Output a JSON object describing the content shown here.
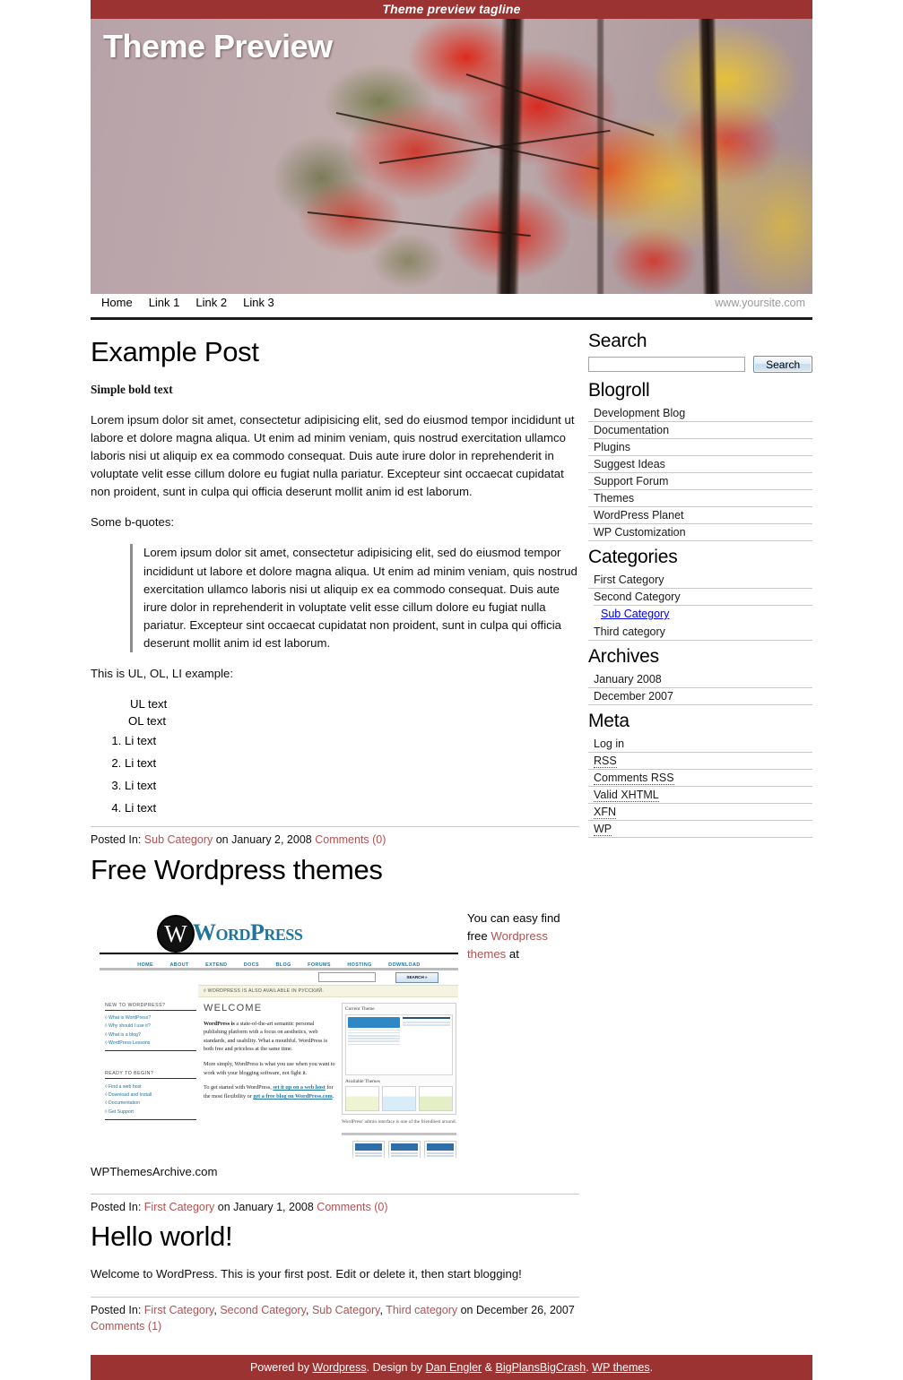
{
  "theme": {
    "accent_red": "#9c3333",
    "link_red": "#b05252",
    "site_title": "Theme Preview",
    "tagline": "Theme preview tagline"
  },
  "nav": {
    "items": [
      {
        "label": "Home"
      },
      {
        "label": "Link 1"
      },
      {
        "label": "Link 2"
      },
      {
        "label": "Link 3"
      }
    ],
    "site_url": "www.yoursite.com"
  },
  "posts": [
    {
      "title": "Example Post",
      "bold_lead": "Simple bold text",
      "paragraph": "Lorem ipsum dolor sit amet, consectetur adipisicing elit, sed do eiusmod tempor incididunt ut labore et dolore magna aliqua. Ut enim ad minim veniam, quis nostrud exercitation ullamco laboris nisi ut aliquip ex ea commodo consequat. Duis aute irure dolor in reprehenderit in voluptate velit esse cillum dolore eu fugiat nulla pariatur. Excepteur sint occaecat cupidatat non proident, sunt in culpa qui officia deserunt mollit anim id est laborum.",
      "bquote_intro": "Some b-quotes:",
      "blockquote": "Lorem ipsum dolor sit amet, consectetur adipisicing elit, sed do eiusmod tempor incididunt ut labore et dolore magna aliqua. Ut enim ad minim veniam, quis nostrud exercitation ullamco laboris nisi ut aliquip ex ea commodo consequat. Duis aute irure dolor in reprehenderit in voluptate velit esse cillum dolore eu fugiat nulla pariatur. Excepteur sint occaecat cupidatat non proident, sunt in culpa qui officia deserunt mollit anim id est laborum.",
      "list_intro": "This is UL, OL, LI example:",
      "ul_text": "UL text",
      "ol_text": "OL text",
      "li_items": [
        "Li text",
        "Li text",
        "Li text",
        "Li text"
      ],
      "meta": {
        "posted_in_label": "Posted In:",
        "categories": [
          "Sub Category"
        ],
        "on_label": "on",
        "date": "January 2, 2008",
        "comments": "Comments (0)"
      }
    },
    {
      "title": "Free Wordpress themes",
      "float_text_before": "You can easy find free ",
      "float_link": "Wordpress themes",
      "float_text_after": " at",
      "caption": "WPThemesArchive.com",
      "meta": {
        "posted_in_label": "Posted In:",
        "categories": [
          "First Category"
        ],
        "on_label": "on",
        "date": "January 1, 2008",
        "comments": "Comments (0)"
      }
    },
    {
      "title": "Hello world!",
      "paragraph": "Welcome to WordPress. This is your first post. Edit or delete it, then start blogging!",
      "meta": {
        "posted_in_label": "Posted In:",
        "categories": [
          "First Category",
          "Second Category",
          "Sub Category",
          "Third category"
        ],
        "on_label": "on",
        "date": "December 26, 2007",
        "comments": "Comments (1)"
      }
    }
  ],
  "wp_screenshot": {
    "wordmark": "WordPress",
    "mark_letter": "W",
    "nav": [
      "HOME",
      "ABOUT",
      "EXTEND",
      "DOCS",
      "BLOG",
      "FORUMS",
      "HOSTING",
      "DOWNLOAD"
    ],
    "search_button": "SEARCH »",
    "banner": "◊ WORDPRESS IS ALSO AVAILABLE IN РУССКИЙ.",
    "welcome_heading": "WELCOME",
    "welcome_p1_bold": "WordPress is",
    "welcome_p1": " a state-of-the-art semantic personal publishing platform with a focus on aesthetics, web standards, and usability. What a mouthful. WordPress is both free and priceless at the same time.",
    "welcome_p2": "More simply, WordPress is what you use when you want to work with your blogging software, not fight it.",
    "welcome_p3_pre": "To get started with WordPress, ",
    "welcome_p3_link1": "set it up on a web host",
    "welcome_p3_mid": " for the most flexibility or ",
    "welcome_p3_link2": "get a free blog on WordPress.com",
    "welcome_p3_end": ".",
    "left_blocks": [
      {
        "heading": "NEW TO WORDPRESS?",
        "items": [
          "◊ What is WordPress?",
          "◊ Why should I use it?",
          "◊ What is a blog?",
          "◊ WordPress Lessons"
        ]
      },
      {
        "heading": "READY TO BEGIN?",
        "items": [
          "◊ Find a web host",
          "◊ Download and Install",
          "◊ Documentation",
          "◊ Get Support"
        ]
      }
    ],
    "current_theme_title": "Current Theme",
    "available_themes_title": "Available Themes",
    "admin_caption": "WordPress' admin interface is one of the friendliest around."
  },
  "sidebar": {
    "search": {
      "heading": "Search",
      "value": "",
      "placeholder": "",
      "button_label": "Search"
    },
    "blogroll": {
      "heading": "Blogroll",
      "items": [
        "Development Blog",
        "Documentation",
        "Plugins",
        "Suggest Ideas",
        "Support Forum",
        "Themes",
        "WordPress Planet",
        "WP Customization"
      ]
    },
    "categories": {
      "heading": "Categories",
      "items": [
        {
          "label": "First Category",
          "children": []
        },
        {
          "label": "Second Category",
          "children": [
            "Sub Category"
          ]
        },
        {
          "label": "Third category",
          "children": []
        }
      ]
    },
    "archives": {
      "heading": "Archives",
      "items": [
        "January 2008",
        "December 2007"
      ]
    },
    "meta": {
      "heading": "Meta",
      "items": [
        {
          "label": "Log in",
          "abbr": false
        },
        {
          "label": "RSS",
          "abbr": true
        },
        {
          "label": "Comments RSS",
          "abbr": true
        },
        {
          "label": "Valid XHTML",
          "abbr": true
        },
        {
          "label": "XFN",
          "abbr": true
        },
        {
          "label": "WP",
          "abbr": true
        }
      ]
    }
  },
  "footer": {
    "powered_by": "Powered by ",
    "wordpress": "Wordpress",
    "design_by": ". Design by ",
    "designer1": "Dan Engler",
    "amp": " & ",
    "designer2": "BigPlansBigCrash",
    "sep": ". ",
    "wp_themes": "WP themes",
    "period": "."
  }
}
